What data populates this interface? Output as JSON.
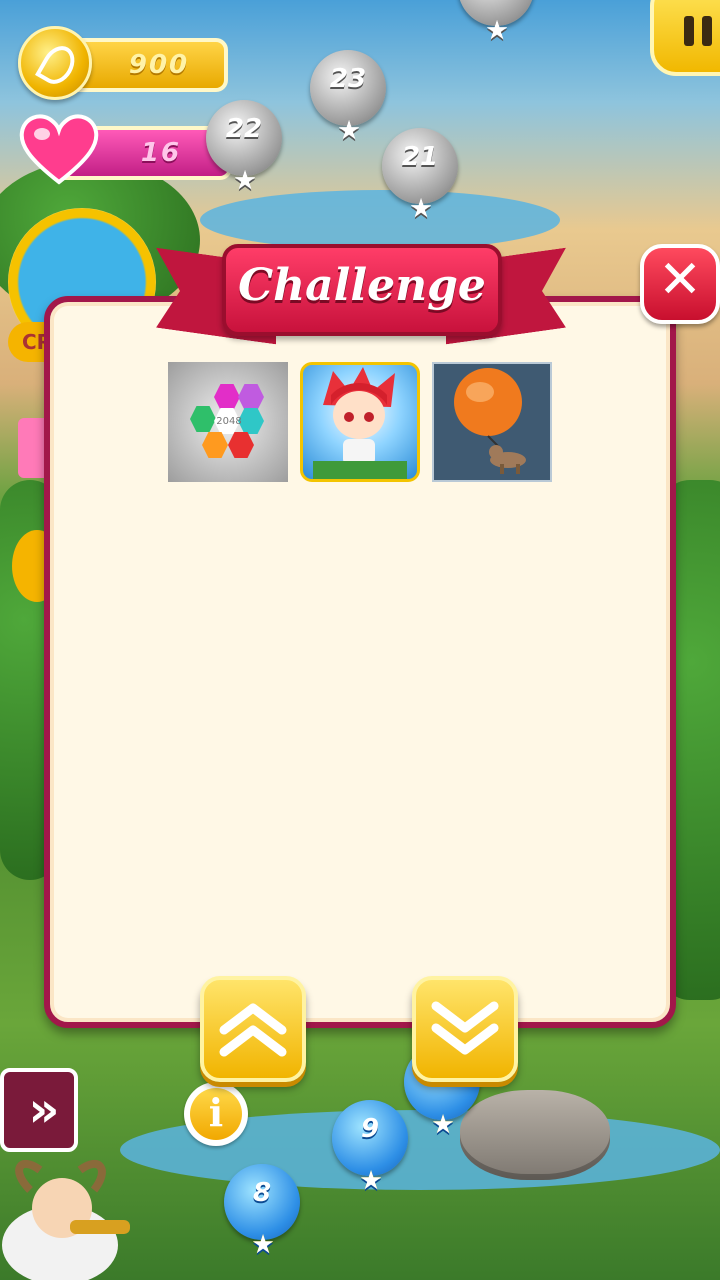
{
  "hud": {
    "coins": "900",
    "lives": "16"
  },
  "map": {
    "levels": [
      {
        "number": "23",
        "stars": 0
      },
      {
        "number": "22",
        "stars": 0
      },
      {
        "number": "21",
        "stars": 0
      },
      {
        "number": "9",
        "stars": 2
      },
      {
        "number": "8",
        "stars": 2
      }
    ],
    "partial_level_stars": 2
  },
  "left_panel": {
    "crossed_label": "CR"
  },
  "modal": {
    "title": "Challenge",
    "close_glyph": "✕",
    "games": [
      {
        "name": "2048 hex puzzle",
        "label": "2048"
      },
      {
        "name": "red haired hero"
      },
      {
        "name": "balloon dog"
      }
    ]
  },
  "buttons": {
    "info_glyph": "i",
    "forward_glyph": "»",
    "up": "scroll-up",
    "down": "scroll-down"
  },
  "colors": {
    "modal_border": "#a2174a",
    "ribbon": "#c8123c",
    "button_yellow": "#f1b400"
  }
}
